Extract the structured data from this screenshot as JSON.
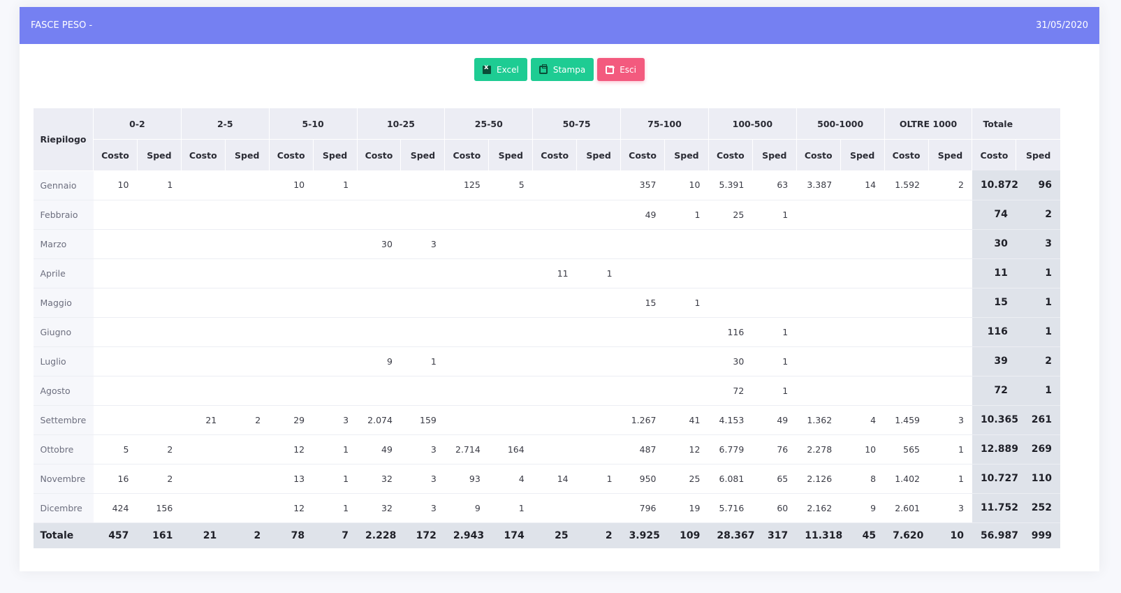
{
  "header": {
    "title": "FASCE PESO -",
    "date": "31/05/2020"
  },
  "buttons": {
    "excel": "Excel",
    "stampa": "Stampa",
    "esci": "Esci"
  },
  "table": {
    "riepilogo_label": "Riepilogo",
    "bands": [
      "0-2",
      "2-5",
      "5-10",
      "10-25",
      "25-50",
      "50-75",
      "75-100",
      "100-500",
      "500-1000",
      "OLTRE 1000",
      "Totale"
    ],
    "sub_costo": "Costo",
    "sub_sped": "Sped",
    "rows": [
      {
        "month": "Gennaio",
        "cells": [
          "10",
          "1",
          "",
          "",
          "10",
          "1",
          "",
          "",
          "125",
          "5",
          "",
          "",
          "357",
          "10",
          "5.391",
          "63",
          "3.387",
          "14",
          "1.592",
          "2",
          "10.872",
          "96"
        ]
      },
      {
        "month": "Febbraio",
        "cells": [
          "",
          "",
          "",
          "",
          "",
          "",
          "",
          "",
          "",
          "",
          "",
          "",
          "49",
          "1",
          "25",
          "1",
          "",
          "",
          "",
          "",
          "74",
          "2"
        ]
      },
      {
        "month": "Marzo",
        "cells": [
          "",
          "",
          "",
          "",
          "",
          "",
          "30",
          "3",
          "",
          "",
          "",
          "",
          "",
          "",
          "",
          "",
          "",
          "",
          "",
          "",
          "30",
          "3"
        ]
      },
      {
        "month": "Aprile",
        "cells": [
          "",
          "",
          "",
          "",
          "",
          "",
          "",
          "",
          "",
          "",
          "11",
          "1",
          "",
          "",
          "",
          "",
          "",
          "",
          "",
          "",
          "11",
          "1"
        ]
      },
      {
        "month": "Maggio",
        "cells": [
          "",
          "",
          "",
          "",
          "",
          "",
          "",
          "",
          "",
          "",
          "",
          "",
          "15",
          "1",
          "",
          "",
          "",
          "",
          "",
          "",
          "15",
          "1"
        ]
      },
      {
        "month": "Giugno",
        "cells": [
          "",
          "",
          "",
          "",
          "",
          "",
          "",
          "",
          "",
          "",
          "",
          "",
          "",
          "",
          "116",
          "1",
          "",
          "",
          "",
          "",
          "116",
          "1"
        ]
      },
      {
        "month": "Luglio",
        "cells": [
          "",
          "",
          "",
          "",
          "",
          "",
          "9",
          "1",
          "",
          "",
          "",
          "",
          "",
          "",
          "30",
          "1",
          "",
          "",
          "",
          "",
          "39",
          "2"
        ]
      },
      {
        "month": "Agosto",
        "cells": [
          "",
          "",
          "",
          "",
          "",
          "",
          "",
          "",
          "",
          "",
          "",
          "",
          "",
          "",
          "72",
          "1",
          "",
          "",
          "",
          "",
          "72",
          "1"
        ]
      },
      {
        "month": "Settembre",
        "cells": [
          "",
          "",
          "21",
          "2",
          "29",
          "3",
          "2.074",
          "159",
          "",
          "",
          "",
          "",
          "1.267",
          "41",
          "4.153",
          "49",
          "1.362",
          "4",
          "1.459",
          "3",
          "10.365",
          "261"
        ]
      },
      {
        "month": "Ottobre",
        "cells": [
          "5",
          "2",
          "",
          "",
          "12",
          "1",
          "49",
          "3",
          "2.714",
          "164",
          "",
          "",
          "487",
          "12",
          "6.779",
          "76",
          "2.278",
          "10",
          "565",
          "1",
          "12.889",
          "269"
        ]
      },
      {
        "month": "Novembre",
        "cells": [
          "16",
          "2",
          "",
          "",
          "13",
          "1",
          "32",
          "3",
          "93",
          "4",
          "14",
          "1",
          "950",
          "25",
          "6.081",
          "65",
          "2.126",
          "8",
          "1.402",
          "1",
          "10.727",
          "110"
        ]
      },
      {
        "month": "Dicembre",
        "cells": [
          "424",
          "156",
          "",
          "",
          "12",
          "1",
          "32",
          "3",
          "9",
          "1",
          "",
          "",
          "796",
          "19",
          "5.716",
          "60",
          "2.162",
          "9",
          "2.601",
          "3",
          "11.752",
          "252"
        ]
      }
    ],
    "total_row": {
      "label": "Totale",
      "cells": [
        "457",
        "161",
        "21",
        "2",
        "78",
        "7",
        "2.228",
        "172",
        "2.943",
        "174",
        "25",
        "2",
        "3.925",
        "109",
        "28.367",
        "317",
        "11.318",
        "45",
        "7.620",
        "10",
        "56.987",
        "999"
      ]
    }
  }
}
